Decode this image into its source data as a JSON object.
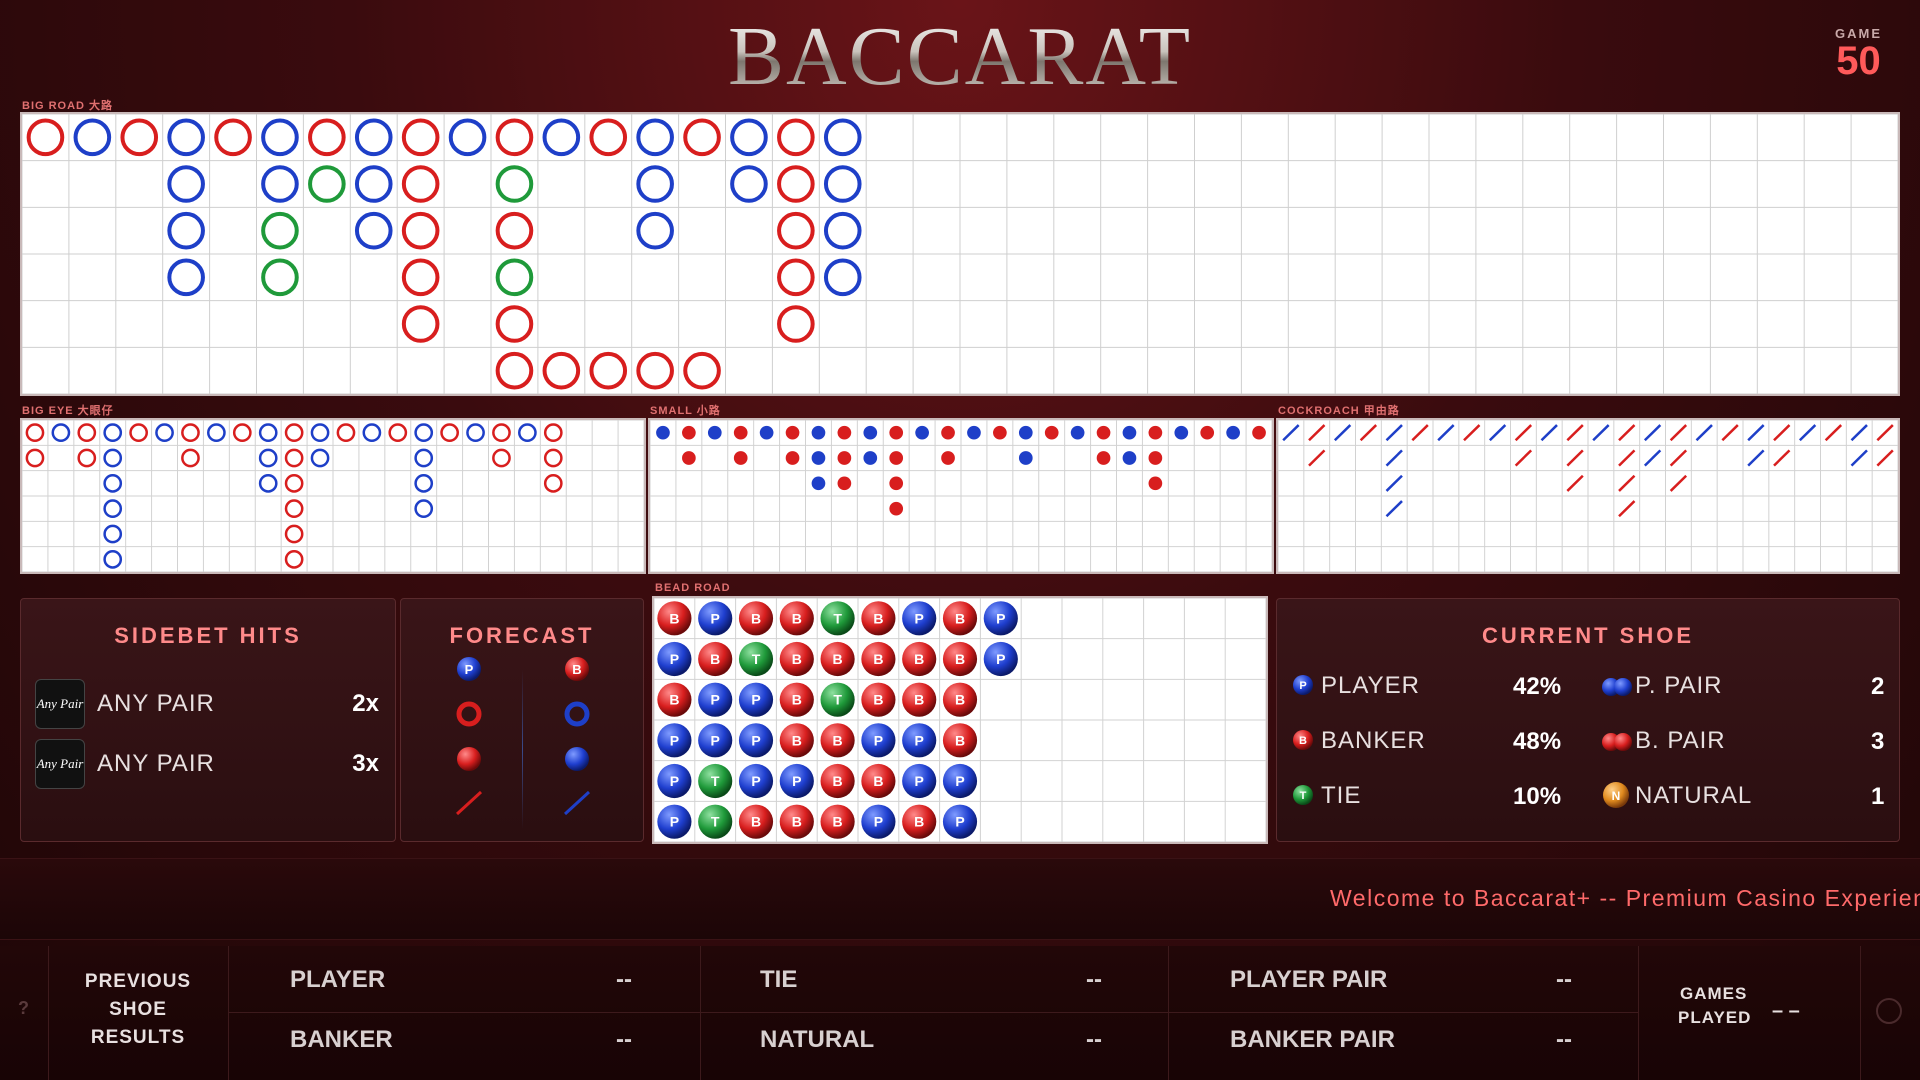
{
  "header": {
    "title": "BACCARAT",
    "game_label": "GAME",
    "game_number": "50"
  },
  "labels": {
    "big_road": "BIG ROAD 大路",
    "big_eye": "BIG EYE 大眼仔",
    "small": "SMALL 小路",
    "cockroach": "COCKROACH 甲由路",
    "bead_road": "BEAD ROAD"
  },
  "colors": {
    "banker": "#d81e1e",
    "player": "#1e3fc8",
    "tie": "#1f9a3a",
    "accent": "#ff8a8a"
  },
  "big_road": {
    "columns": [
      [
        "B"
      ],
      [
        "P"
      ],
      [
        "B"
      ],
      [
        "P",
        "P",
        "P",
        "P"
      ],
      [
        "B"
      ],
      [
        "P",
        "P",
        "T",
        "T"
      ],
      [
        "B",
        "T"
      ],
      [
        "P",
        "P",
        "P"
      ],
      [
        "B",
        "B",
        "B",
        "B",
        "B"
      ],
      [
        "P"
      ],
      [
        "B",
        "T",
        "B",
        "T",
        "B",
        "B"
      ],
      [
        "P"
      ],
      [
        "B"
      ],
      [
        "P",
        "P",
        "P"
      ],
      [
        "B"
      ],
      [
        "P",
        "P"
      ],
      [
        "B",
        "B",
        "B",
        "B",
        "B"
      ],
      [
        "P",
        "P",
        "P",
        "P"
      ]
    ],
    "tail_row": [
      {
        "col": 11,
        "value": "B"
      },
      {
        "col": 12,
        "value": "B"
      },
      {
        "col": 13,
        "value": "B"
      },
      {
        "col": 14,
        "value": "B"
      }
    ]
  },
  "big_eye": {
    "columns": [
      [
        "R",
        "R"
      ],
      [
        "P"
      ],
      [
        "R",
        "R"
      ],
      [
        "P",
        "P",
        "P",
        "P",
        "P",
        "P"
      ],
      [
        "R"
      ],
      [
        "P"
      ],
      [
        "R",
        "R"
      ],
      [
        "P"
      ],
      [
        "R"
      ],
      [
        "P",
        "P",
        "P"
      ],
      [
        "R",
        "R",
        "R",
        "R",
        "R",
        "R"
      ],
      [
        "P",
        "P"
      ],
      [
        "R"
      ],
      [
        "P"
      ],
      [
        "R"
      ],
      [
        "P",
        "P",
        "P",
        "P"
      ],
      [
        "R"
      ],
      [
        "P"
      ],
      [
        "R",
        "R"
      ],
      [
        "P"
      ],
      [
        "R",
        "R",
        "R"
      ]
    ]
  },
  "small_road": {
    "columns": [
      [
        "P"
      ],
      [
        "R",
        "R"
      ],
      [
        "P"
      ],
      [
        "R",
        "R"
      ],
      [
        "P"
      ],
      [
        "R",
        "R"
      ],
      [
        "P",
        "P",
        "P"
      ],
      [
        "R",
        "R",
        "R"
      ],
      [
        "P",
        "P"
      ],
      [
        "R",
        "R",
        "R",
        "R"
      ],
      [
        "P"
      ],
      [
        "R",
        "R"
      ],
      [
        "P"
      ],
      [
        "R"
      ],
      [
        "P",
        "P"
      ],
      [
        "R"
      ],
      [
        "P"
      ],
      [
        "R",
        "R"
      ],
      [
        "P",
        "P"
      ],
      [
        "R",
        "R",
        "R"
      ],
      [
        "P"
      ],
      [
        "R"
      ],
      [
        "P"
      ],
      [
        "R"
      ]
    ]
  },
  "cockroach": {
    "columns": [
      [
        "P"
      ],
      [
        "R",
        "R"
      ],
      [
        "P"
      ],
      [
        "R"
      ],
      [
        "P",
        "P",
        "P",
        "P"
      ],
      [
        "R"
      ],
      [
        "P"
      ],
      [
        "R"
      ],
      [
        "P"
      ],
      [
        "R",
        "R"
      ],
      [
        "P"
      ],
      [
        "R",
        "R",
        "R"
      ],
      [
        "P"
      ],
      [
        "R",
        "R",
        "R",
        "R"
      ],
      [
        "P",
        "P"
      ],
      [
        "R",
        "R",
        "R"
      ],
      [
        "P"
      ],
      [
        "R"
      ],
      [
        "P",
        "P"
      ],
      [
        "R",
        "R"
      ],
      [
        "P"
      ],
      [
        "R"
      ],
      [
        "P",
        "P"
      ],
      [
        "R",
        "R"
      ]
    ]
  },
  "bead_road": {
    "columns": [
      [
        "B",
        "P",
        "B",
        "P",
        "P",
        "P"
      ],
      [
        "P",
        "B",
        "P",
        "P",
        "T",
        "T"
      ],
      [
        "B",
        "T",
        "P",
        "P",
        "P",
        "B"
      ],
      [
        "B",
        "B",
        "B",
        "B",
        "P",
        "B"
      ],
      [
        "T",
        "B",
        "T",
        "B",
        "B",
        "B"
      ],
      [
        "B",
        "B",
        "B",
        "P",
        "B",
        "P"
      ],
      [
        "P",
        "B",
        "B",
        "P",
        "P",
        "B"
      ],
      [
        "B",
        "B",
        "B",
        "B",
        "P",
        "P"
      ],
      [
        "P",
        "P"
      ]
    ]
  },
  "sidebet": {
    "title": "SIDEBET HITS",
    "icon_text": "Any Pair",
    "rows": [
      {
        "label": "ANY PAIR",
        "value": "2x"
      },
      {
        "label": "ANY PAIR",
        "value": "3x"
      }
    ]
  },
  "forecast": {
    "title": "FORECAST",
    "player_badge": "P",
    "banker_badge": "B"
  },
  "current_shoe": {
    "title": "CURRENT SHOE",
    "player_label": "PLAYER",
    "player_pct": "42%",
    "banker_label": "BANKER",
    "banker_pct": "48%",
    "tie_label": "TIE",
    "tie_pct": "10%",
    "ppair_label": "P. PAIR",
    "ppair_count": "2",
    "bpair_label": "B. PAIR",
    "bpair_count": "3",
    "natural_label": "NATURAL",
    "natural_count": "1"
  },
  "ticker": "Welcome to Baccarat+ -- Premium Casino Experience",
  "footer": {
    "help": "?",
    "previous_line1": "PREVIOUS",
    "previous_line2": "SHOE",
    "previous_line3": "RESULTS",
    "player_label": "PLAYER",
    "player_value": "--",
    "banker_label": "BANKER",
    "banker_value": "--",
    "tie_label": "TIE",
    "tie_value": "--",
    "natural_label": "NATURAL",
    "natural_value": "--",
    "ppair_label": "PLAYER PAIR",
    "ppair_value": "--",
    "bpair_label": "BANKER PAIR",
    "bpair_value": "--",
    "games_played_line1": "GAMES",
    "games_played_line2": "PLAYED",
    "games_played_value": "– –",
    "settings_icon": "gear-icon"
  }
}
